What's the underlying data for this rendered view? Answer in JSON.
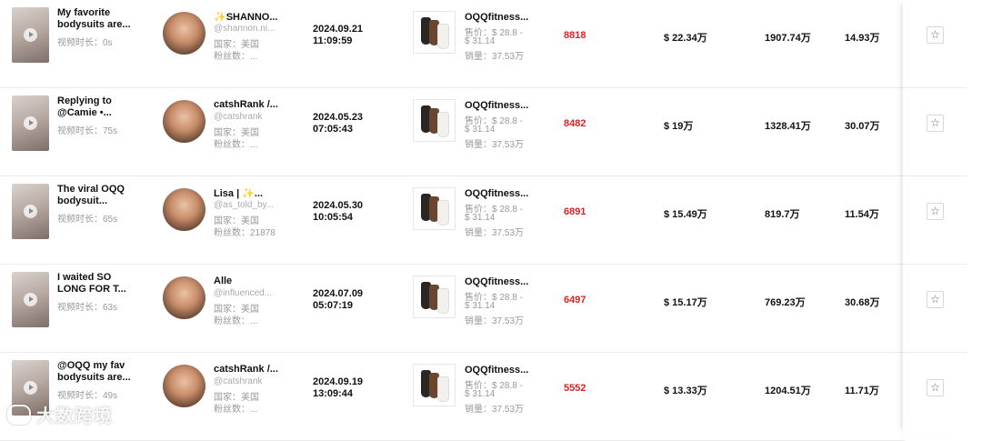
{
  "rows": [
    {
      "video_title": "My favorite bodysuits are...",
      "duration": "视频时长：0s",
      "creator_name": "✨SHANNO...",
      "creator_handle": "@shannon.ni...",
      "country": "国家：美国",
      "fans": "粉丝数：...",
      "date": "2024.09.21",
      "time": "11:09:59",
      "product_name": "OQQfitness...",
      "price_line1": "售价：$ 28.8 -",
      "price_line2": "$ 31.14",
      "product_sales": "销量：37.53万",
      "metric_red": "8818",
      "gmv": "$ 22.34万",
      "views": "1907.74万",
      "metric_last": "14.93万"
    },
    {
      "video_title": "Replying to @Camie •...",
      "duration": "视频时长：75s",
      "creator_name": "catshRank /...",
      "creator_handle": "@catshrank",
      "country": "国家：美国",
      "fans": "粉丝数：...",
      "date": "2024.05.23",
      "time": "07:05:43",
      "product_name": "OQQfitness...",
      "price_line1": "售价：$ 28.8 -",
      "price_line2": "$ 31.14",
      "product_sales": "销量：37.53万",
      "metric_red": "8482",
      "gmv": "$ 19万",
      "views": "1328.41万",
      "metric_last": "30.07万"
    },
    {
      "video_title": "The viral OQQ bodysuit...",
      "duration": "视频时长：65s",
      "creator_name": "Lisa | ✨...",
      "creator_handle": "@as_told_by...",
      "country": "国家：美国",
      "fans": "粉丝数：21878",
      "date": "2024.05.30",
      "time": "10:05:54",
      "product_name": "OQQfitness...",
      "price_line1": "售价：$ 28.8 -",
      "price_line2": "$ 31.14",
      "product_sales": "销量：37.53万",
      "metric_red": "6891",
      "gmv": "$ 15.49万",
      "views": "819.7万",
      "metric_last": "11.54万"
    },
    {
      "video_title": "I waited SO LONG FOR T...",
      "duration": "视频时长：63s",
      "creator_name": "Alle",
      "creator_handle": "@influenced...",
      "country": "国家：美国",
      "fans": "粉丝数：...",
      "date": "2024.07.09",
      "time": "05:07:19",
      "product_name": "OQQfitness...",
      "price_line1": "售价：$ 28.8 -",
      "price_line2": "$ 31.14",
      "product_sales": "销量：37.53万",
      "metric_red": "6497",
      "gmv": "$ 15.17万",
      "views": "769.23万",
      "metric_last": "30.68万"
    },
    {
      "video_title": "@OQQ my fav bodysuits are...",
      "duration": "视频时长：49s",
      "creator_name": "catshRank /...",
      "creator_handle": "@catshrank",
      "country": "国家：美国",
      "fans": "粉丝数：...",
      "date": "2024.09.19",
      "time": "13:09:44",
      "product_name": "OQQfitness...",
      "price_line1": "售价：$ 28.8 -",
      "price_line2": "$ 31.14",
      "product_sales": "销量：37.53万",
      "metric_red": "5552",
      "gmv": "$ 13.33万",
      "views": "1204.51万",
      "metric_last": "11.71万"
    }
  ],
  "favorite_icon": "star-outline-icon",
  "favorite_glyph": "☆",
  "watermark": "大数跨境",
  "colors": {
    "highlight_red": "#e02020",
    "muted": "#999999",
    "border": "#ececec"
  }
}
